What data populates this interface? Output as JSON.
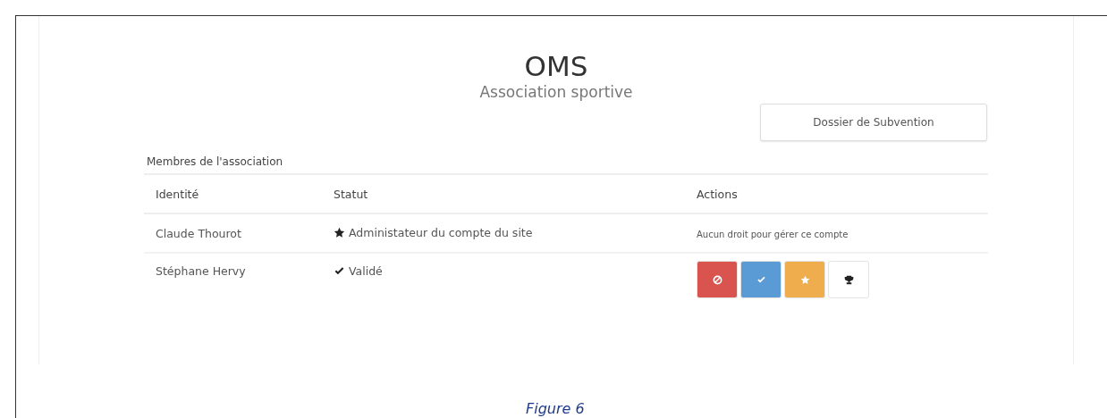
{
  "header": {
    "title": "OMS",
    "subtitle": "Association sportive"
  },
  "subsidy_button": "Dossier de Subvention",
  "section_title": "Membres de l'association",
  "table": {
    "columns": [
      "Identité",
      "Statut",
      "Actions"
    ],
    "rows": [
      {
        "identity": "Claude Thourot",
        "status": {
          "kind": "star",
          "label": "Administateur du compte du site"
        },
        "actions": {
          "kind": "text",
          "text": "Aucun droit pour gérer ce compte"
        }
      },
      {
        "identity": "Stéphane Hervy",
        "status": {
          "kind": "check",
          "label": "Validé"
        },
        "actions": {
          "kind": "buttons",
          "buttons": [
            {
              "kind": "ban",
              "color": "#d9534f"
            },
            {
              "kind": "check",
              "color": "#5b9bd5"
            },
            {
              "kind": "star",
              "color": "#f0ad4e"
            },
            {
              "kind": "trophy",
              "color": "#ffffff"
            }
          ]
        }
      }
    ]
  },
  "caption": "Figure 6"
}
